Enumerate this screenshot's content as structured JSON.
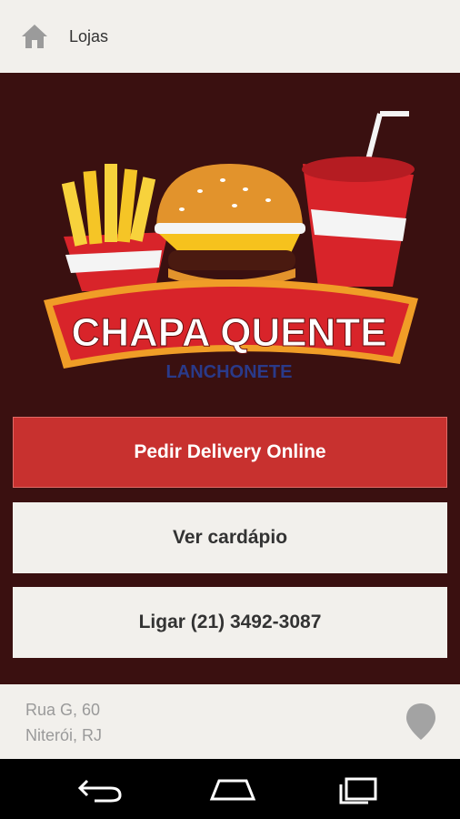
{
  "topbar": {
    "title": "Lojas",
    "home_icon": "home-icon"
  },
  "logo": {
    "title": "CHAPA QUENTE",
    "subtitle": "LANCHONETE"
  },
  "actions": {
    "delivery_label": "Pedir Delivery Online",
    "menu_label": "Ver cardápio",
    "call_label": "Ligar (21) 3492-3087"
  },
  "footer": {
    "address_line1": "Rua G, 60",
    "address_line2": "Niterói, RJ",
    "pin_icon": "map-pin-icon"
  },
  "colors": {
    "background": "#3a1010",
    "accent": "#c8312f",
    "surface": "#f2f0ec"
  },
  "navbar": {
    "icons": [
      "back-icon",
      "home-icon",
      "recent-apps-icon"
    ]
  }
}
